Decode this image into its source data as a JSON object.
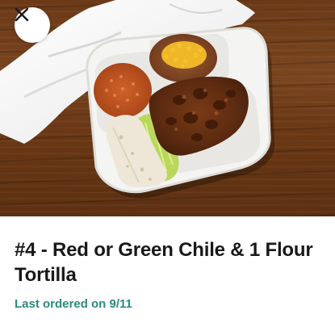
{
  "item": {
    "title": "#4 - Red or Green Chile & 1 Flour Tortilla",
    "last_ordered": "Last ordered on 9/11",
    "image_icon": "food-photo",
    "close_icon": "close-icon"
  },
  "colors": {
    "title": "#191919",
    "last_ordered": "#2b8a7e",
    "close_button_bg": "#ffffff",
    "wood": "#6b3a17"
  }
}
